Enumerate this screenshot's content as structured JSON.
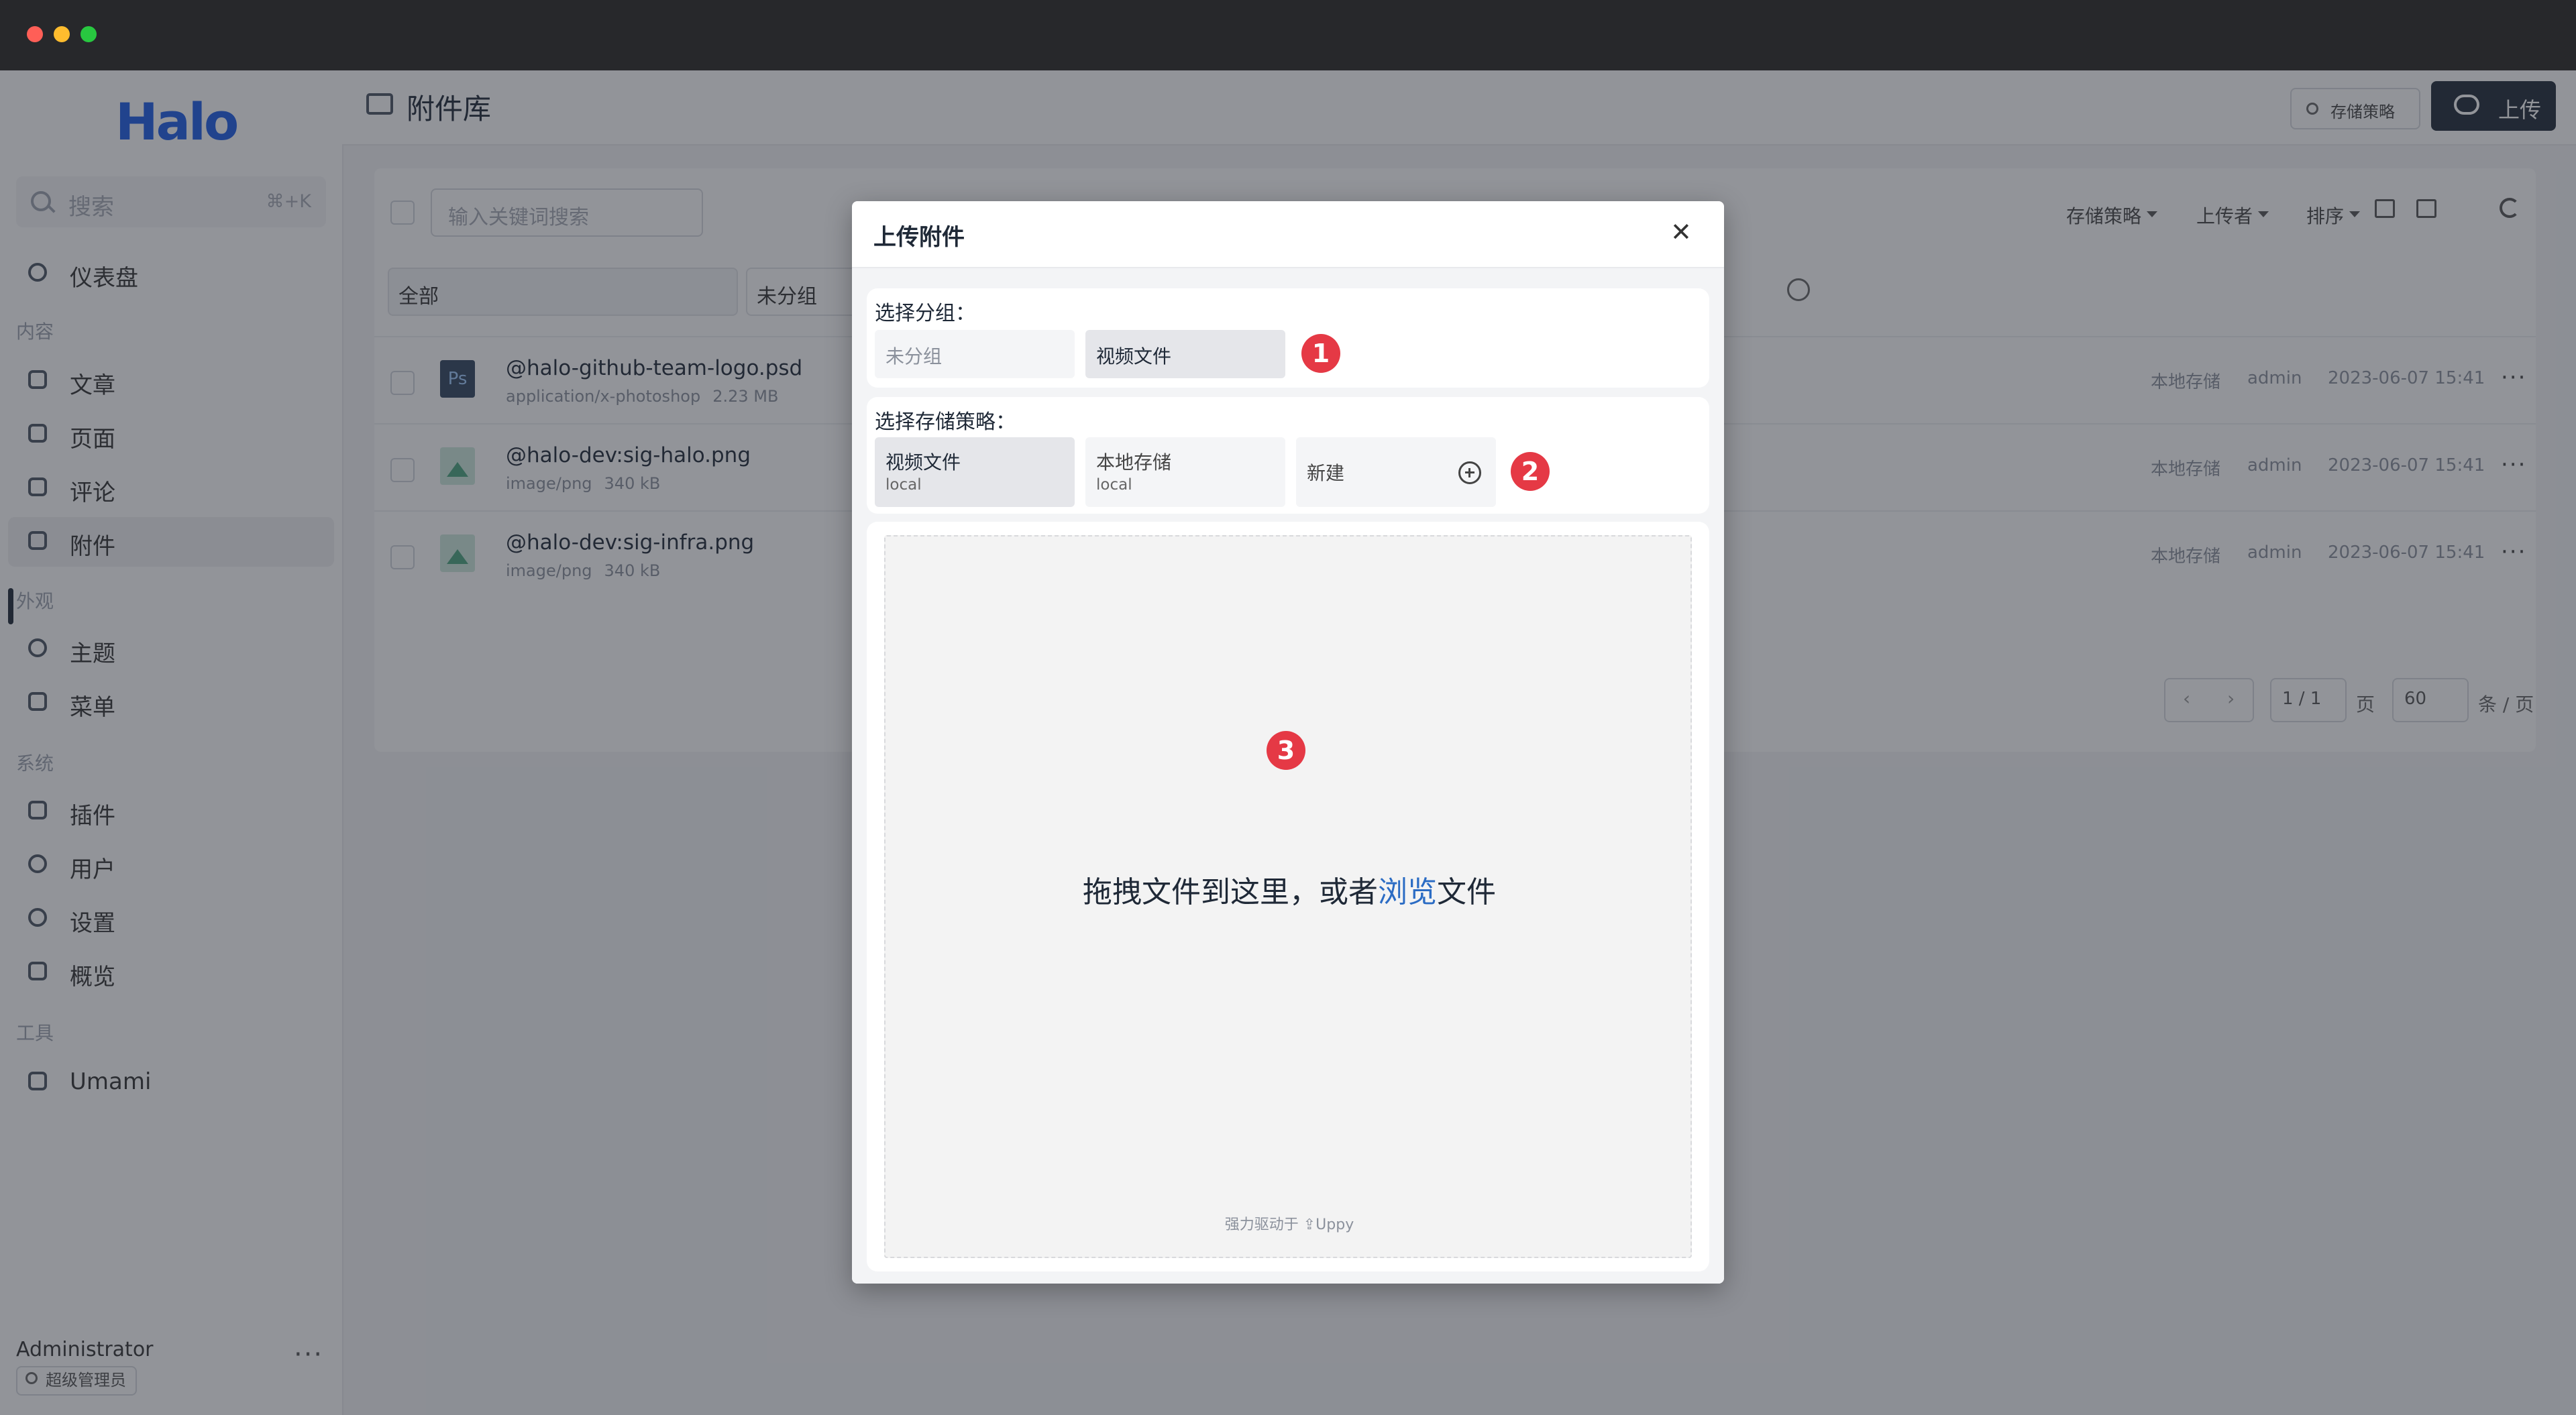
{
  "window": {
    "colors": {
      "close": "#ff5f57",
      "minimize": "#febc2e",
      "zoom": "#28c840"
    }
  },
  "sidebar": {
    "logo": "Halo",
    "search": {
      "placeholder": "搜索",
      "shortcut": "⌘+K"
    },
    "items": [
      {
        "label": "仪表盘",
        "icon": "dashboard-icon"
      },
      {
        "section": "内容"
      },
      {
        "label": "文章",
        "icon": "post-icon"
      },
      {
        "label": "页面",
        "icon": "page-icon"
      },
      {
        "label": "评论",
        "icon": "comment-icon"
      },
      {
        "label": "附件",
        "icon": "folder-icon",
        "active": true
      },
      {
        "section": "外观"
      },
      {
        "label": "主题",
        "icon": "palette-icon"
      },
      {
        "label": "菜单",
        "icon": "menu-icon"
      },
      {
        "section": "系统"
      },
      {
        "label": "插件",
        "icon": "plug-icon"
      },
      {
        "label": "用户",
        "icon": "user-icon"
      },
      {
        "label": "设置",
        "icon": "gear-icon"
      },
      {
        "label": "概览",
        "icon": "terminal-icon"
      },
      {
        "section": "工具"
      },
      {
        "label": "Umami",
        "icon": "chart-icon"
      }
    ],
    "user": {
      "name": "Administrator",
      "role": "超级管理员"
    }
  },
  "header": {
    "title": "附件库",
    "policy_button": "存储策略",
    "upload_button": "上传"
  },
  "toolbar": {
    "search_placeholder": "输入关键词搜索",
    "filters": [
      "存储策略",
      "上传者",
      "排序"
    ]
  },
  "groups": {
    "all": "全部",
    "ungrouped": "未分组"
  },
  "attachments": [
    {
      "name": "@halo-github-team-logo.psd",
      "type": "application/x-photoshop",
      "size": "2.23 MB",
      "policy": "本地存储",
      "owner": "admin",
      "time": "2023-06-07 15:41"
    },
    {
      "name": "@halo-dev:sig-halo.png",
      "type": "image/png",
      "size": "340 kB",
      "policy": "本地存储",
      "owner": "admin",
      "time": "2023-06-07 15:41"
    },
    {
      "name": "@halo-dev:sig-infra.png",
      "type": "image/png",
      "size": "340 kB",
      "policy": "本地存储",
      "owner": "admin",
      "time": "2023-06-07 15:41"
    }
  ],
  "pagination": {
    "page": "1 / 1",
    "page_unit": "页",
    "size": "60",
    "size_unit": "条 / 页"
  },
  "modal": {
    "title": "上传附件",
    "group_label": "选择分组：",
    "groups": [
      "未分组",
      "视频文件"
    ],
    "policy_label": "选择存储策略：",
    "policies": [
      {
        "name": "视频文件",
        "type": "local"
      },
      {
        "name": "本地存储",
        "type": "local"
      }
    ],
    "new_label": "新建",
    "drop_before": "拖拽文件到这里，或者",
    "drop_link": "浏览",
    "drop_after": "文件",
    "powered_by": "强力驱动于 ⇪Uppy",
    "markers": [
      "1",
      "2",
      "3"
    ]
  }
}
